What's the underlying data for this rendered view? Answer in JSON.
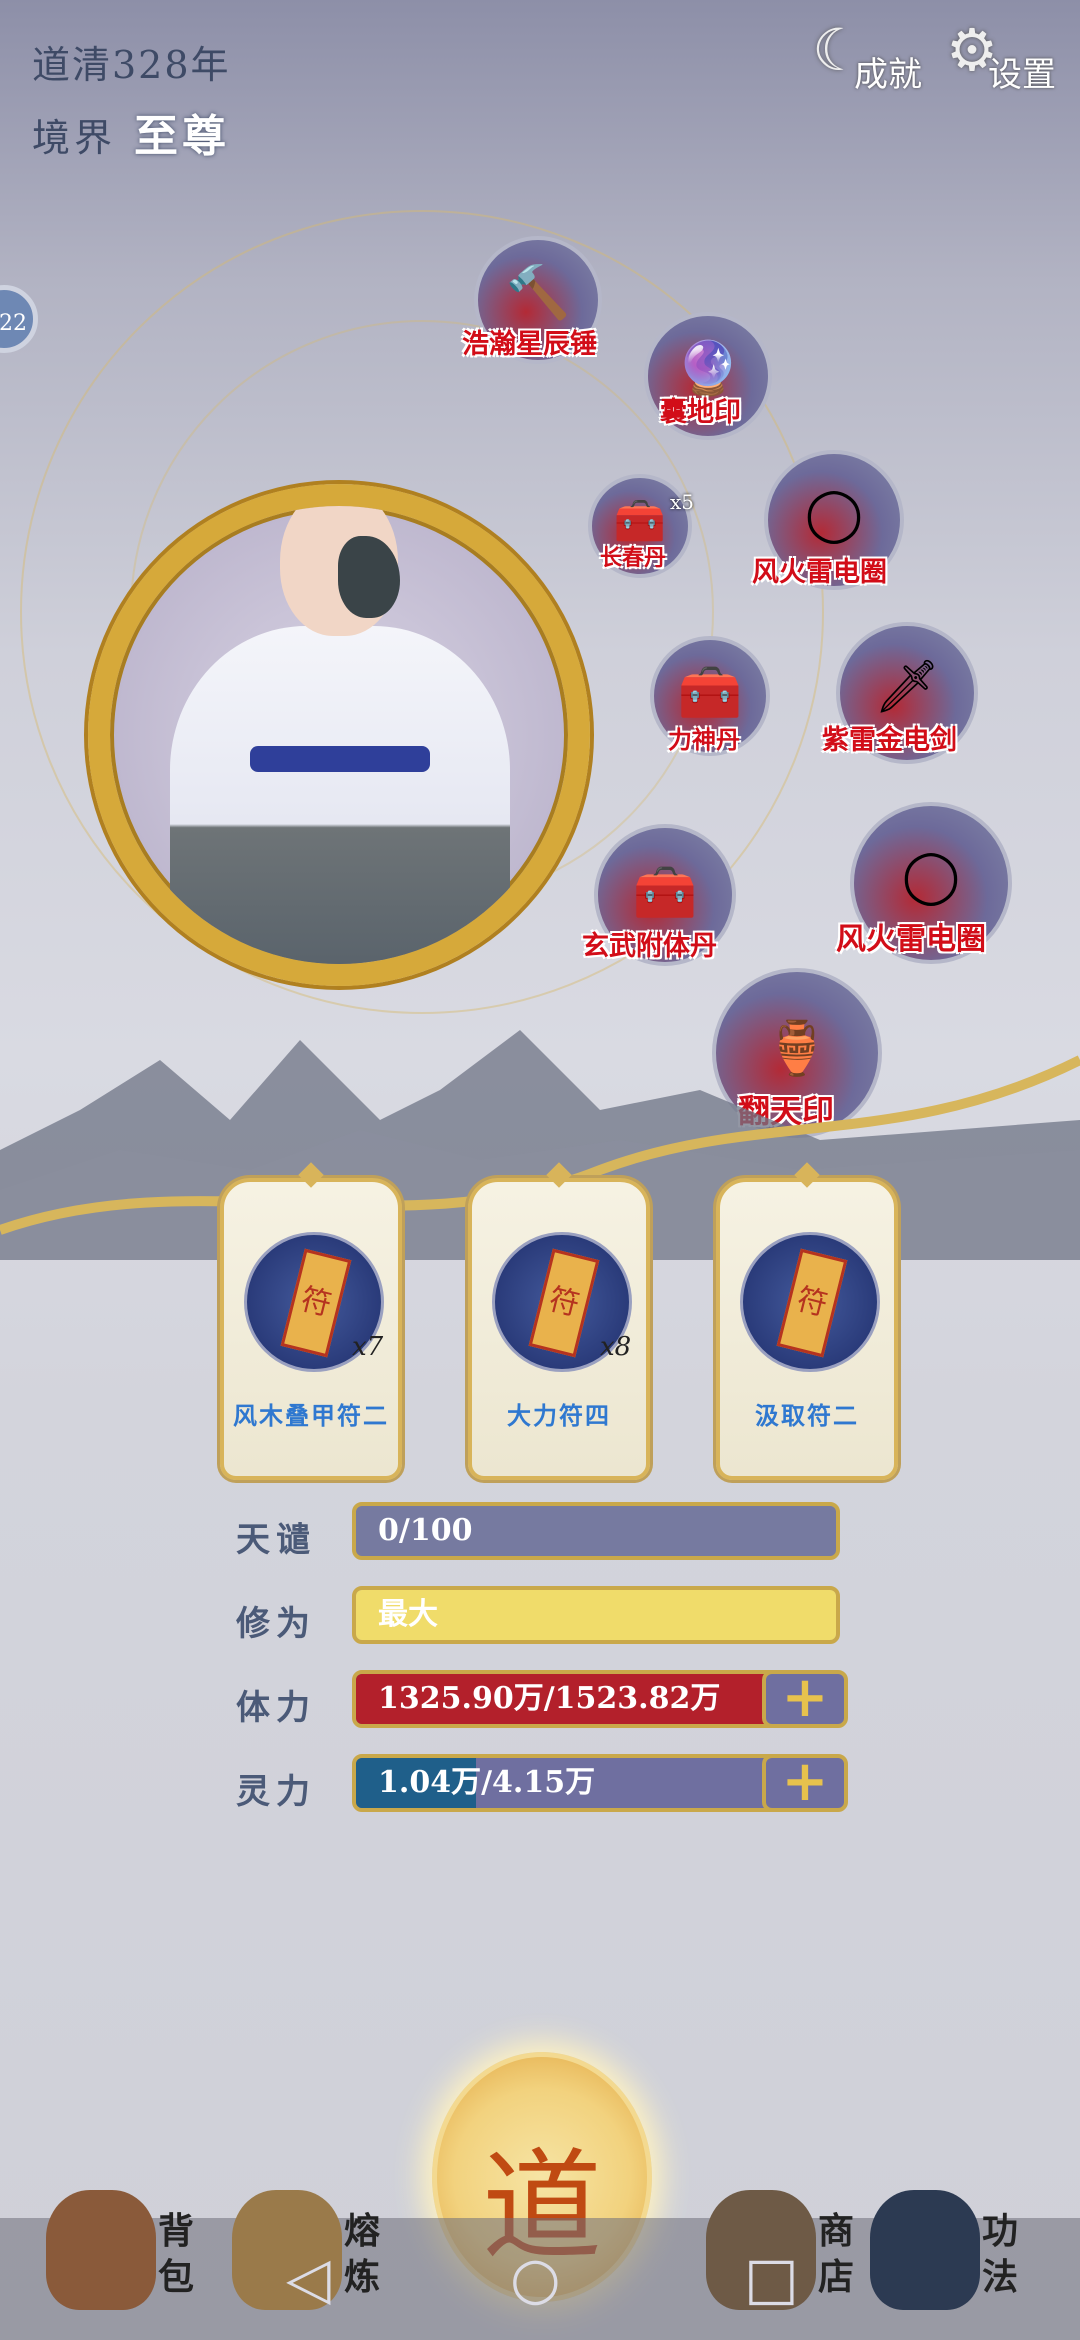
{
  "header": {
    "era": "道清328年",
    "realm_label": "境界",
    "realm_value": "至尊"
  },
  "top_buttons": {
    "achievements": "成就",
    "settings": "设置"
  },
  "side_badge": "22",
  "equipment": [
    {
      "name": "浩瀚星辰锤",
      "icon": "hammer-icon",
      "count": ""
    },
    {
      "name": "囊地印",
      "icon": "orb-icon",
      "count": ""
    },
    {
      "name": "长春丹",
      "icon": "treasure-chest-icon",
      "count": "x5"
    },
    {
      "name": "风火雷电圈",
      "icon": "ring-icon",
      "count": ""
    },
    {
      "name": "力神丹",
      "icon": "treasure-chest-icon",
      "count": ""
    },
    {
      "name": "紫雷金电剑",
      "icon": "sword-icon",
      "count": ""
    },
    {
      "name": "玄武附体丹",
      "icon": "treasure-chest-icon",
      "count": ""
    },
    {
      "name": "风火雷电圈",
      "icon": "ring-icon",
      "count": ""
    },
    {
      "name": "翻天印",
      "icon": "seal-icon",
      "count": ""
    }
  ],
  "talismans": [
    {
      "name": "风木叠甲符二",
      "qty": "x7"
    },
    {
      "name": "大力符四",
      "qty": "x8"
    },
    {
      "name": "汲取符二",
      "qty": ""
    }
  ],
  "stats": {
    "tianqian": {
      "label": "天谴",
      "text": "0/100",
      "fill": 0
    },
    "xiuwei": {
      "label": "修为",
      "text": "最大",
      "fill": 1
    },
    "tili": {
      "label": "体力",
      "text": "1325.90万/1523.82万",
      "fill": 0.87
    },
    "lingli": {
      "label": "灵力",
      "text": "1.04万/4.15万",
      "fill": 0.25
    }
  },
  "center_button": "道",
  "tabs": [
    {
      "label": "背包",
      "icon": "bag-icon"
    },
    {
      "label": "熔炼",
      "icon": "hat-icon"
    },
    {
      "label": "商店",
      "icon": "scroll-icon"
    },
    {
      "label": "功法",
      "icon": "book-icon"
    }
  ],
  "colors": {
    "gold": "#d6a93a",
    "tili": "#b3202b",
    "lingli": "#1f5f8a",
    "xiuwei": "#f0dc6a",
    "tianqian": "#767aa0",
    "label_red": "#d20d18"
  }
}
